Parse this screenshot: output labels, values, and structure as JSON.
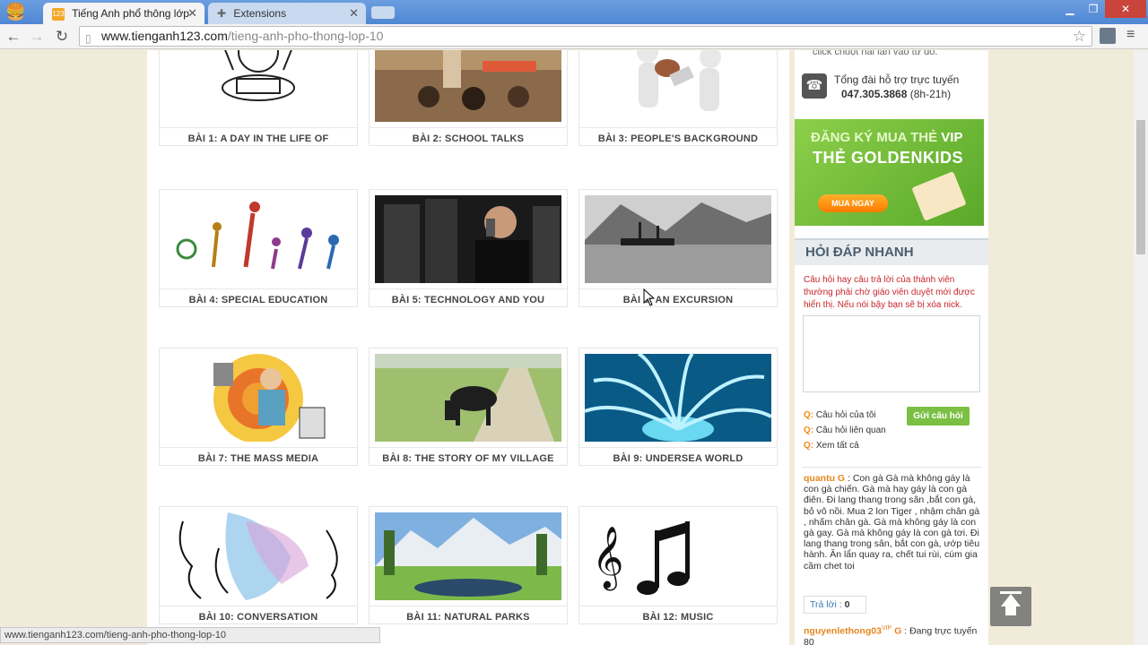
{
  "browser": {
    "tabs": [
      {
        "label": "Tiếng Anh phổ thông lớp",
        "favicon": "123"
      },
      {
        "label": "Extensions"
      }
    ],
    "url_host": "www.tienganh123.com",
    "url_path": "/tieng-anh-pho-thong-lop-10",
    "status_url": "www.tienganh123.com/tieng-anh-pho-thong-lop-10"
  },
  "lessons": [
    {
      "label": "BÀI 1: A DAY IN THE LIFE OF",
      "image": "cartoon-birthday-cake"
    },
    {
      "label": "BÀI 2: SCHOOL TALKS",
      "image": "classroom-photo"
    },
    {
      "label": "BÀI 3: PEOPLE'S BACKGROUND",
      "image": "3d-figures-exchange"
    },
    {
      "label": "BÀI 4: SPECIAL EDUCATION",
      "image": "colorful-people-figures"
    },
    {
      "label": "BÀI 5: TECHNOLOGY AND YOU",
      "image": "man-on-phone"
    },
    {
      "label": "BÀI 6: AN EXCURSION",
      "image": "ship-in-fjord"
    },
    {
      "label": "BÀI 7: THE MASS MEDIA",
      "image": "media-collage"
    },
    {
      "label": "BÀI 8: THE STORY OF MY VILLAGE",
      "image": "cow-on-path"
    },
    {
      "label": "BÀI 9: UNDERSEA WORLD",
      "image": "sea-anemone"
    },
    {
      "label": "BÀI 10: CONVERSATION",
      "image": "faces-sketch"
    },
    {
      "label": "BÀI 11: NATURAL PARKS",
      "image": "mountain-park"
    },
    {
      "label": "BÀI 12: MUSIC",
      "image": "music-notes"
    }
  ],
  "sidebar": {
    "click_hint": "click chuột hai lần vào từ đó.",
    "support_line": "Tổng đài hỗ trợ trực tuyến",
    "support_phone": "047.305.3868",
    "support_hours": "(8h-21h)",
    "banner_line1_prefix": "ĐĂNG KÝ MUA THẺ",
    "banner_line1_vip": "VIP",
    "banner_line2": "THẺ GOLDENKIDS",
    "banner_button": "MUA NGAY",
    "qa_title": "HỎI ĐÁP NHANH",
    "qa_note": "Câu hỏi hay câu trả lời của thành viên thường phải chờ giáo viên duyệt mới được hiển thị. Nếu nói bậy bạn sẽ bị xóa nick.",
    "qa_links": [
      "Câu hỏi của tôi",
      "Câu hỏi liên quan",
      "Xem tất cả"
    ],
    "qa_prefix": "Q:",
    "send_button": "Gửi câu hỏi",
    "comment1_user": "quantu",
    "comment1_badge": "G",
    "comment1_text": ": Con gà Gà mà không gáy là con gà chiến. Gà mà hay gáy là con gà điên. Đi lang thang trong sân ,bắt con gà, bỏ vô nồi. Mua 2 lon Tiger , nhậm chân gà , nhấm chân gà. Gà mà không gáy là con gà gay. Gà mà không gáy là con gà tơi. Đi lang thang trong sân, bắt con gà, ướp tiêu hành. Ăn lẩn quay ra, chết tui rùi, cúm gia cầm chet toi",
    "reply_label": "Trả lời :",
    "reply_count": "0",
    "comment2_user": "nguyenlethong03",
    "comment2_vip": "VIP",
    "comment2_badge": "G",
    "comment2_text": ": Đang trực tuyến 80"
  }
}
